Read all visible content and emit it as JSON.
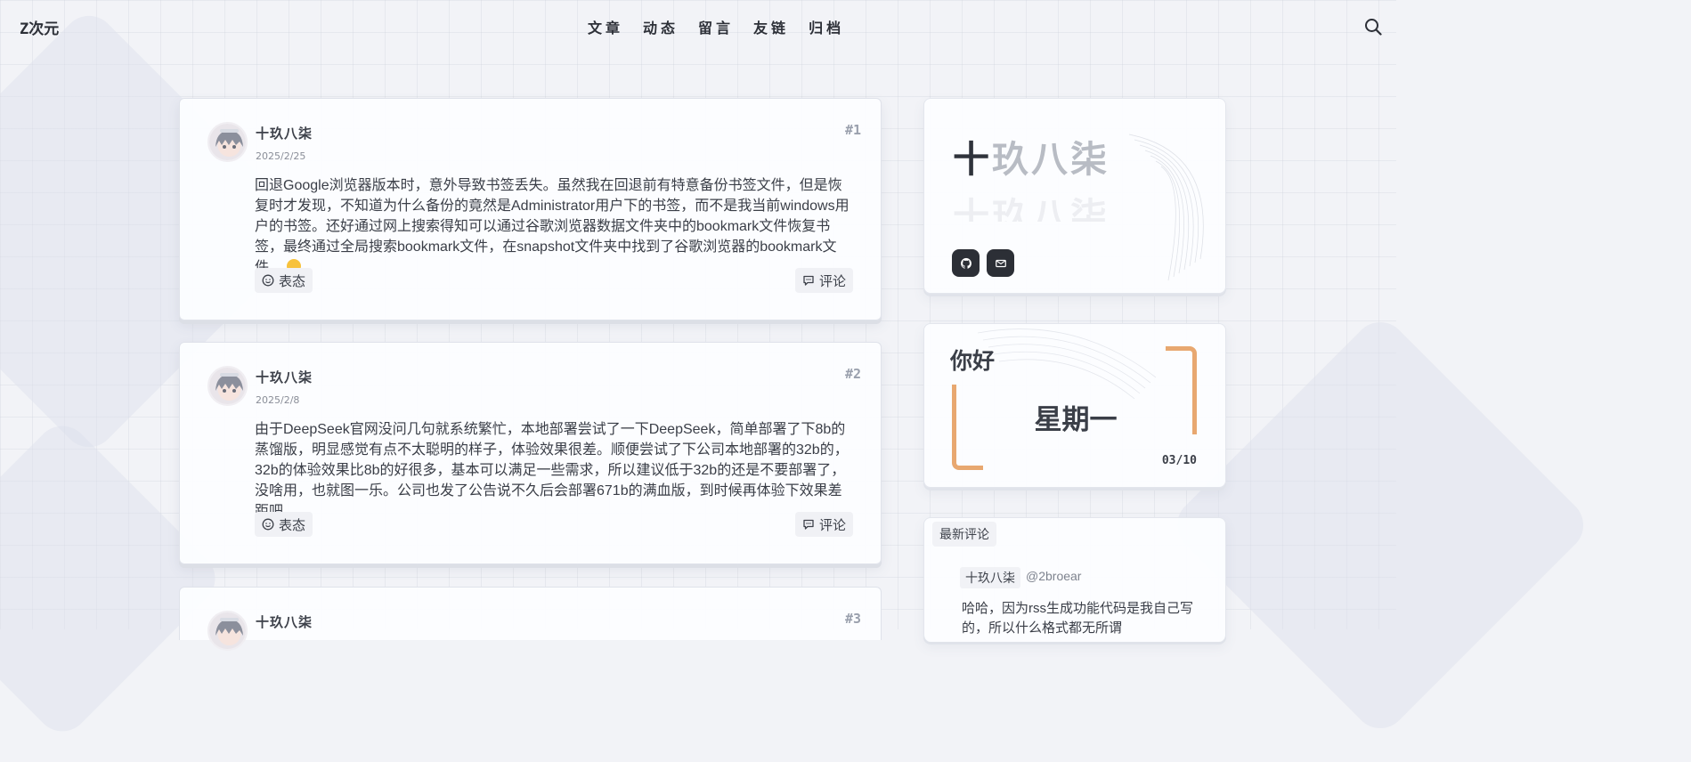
{
  "site": {
    "logo": "Z次元"
  },
  "nav": [
    {
      "label": "文章"
    },
    {
      "label": "动态"
    },
    {
      "label": "留言"
    },
    {
      "label": "友链"
    },
    {
      "label": "归档"
    }
  ],
  "posts": [
    {
      "number": "#1",
      "author": "十玖八柒",
      "date": "2025/2/25",
      "content": "回退Google浏览器版本时，意外导致书签丢失。虽然我在回退前有特意备份书签文件，但是恢复时才发现，不知道为什么备份的竟然是Administrator用户下的书签，而不是我当前windows用户的书签。还好通过网上搜索得知可以通过谷歌浏览器数据文件夹中的bookmark文件恢复书签，最终通过全局搜索bookmark文件，在snapshot文件夹中找到了谷歌浏览器的bookmark文件。",
      "react_label": "表态",
      "comment_label": "评论"
    },
    {
      "number": "#2",
      "author": "十玖八柒",
      "date": "2025/2/8",
      "content": "由于DeepSeek官网没问几句就系统繁忙，本地部署尝试了一下DeepSeek，简单部署了下8b的蒸馏版，明显感觉有点不太聪明的样子，体验效果很差。顺便尝试了下公司本地部署的32b的，32b的体验效果比8b的好很多，基本可以满足一些需求，所以建议低于32b的还是不要部署了，没啥用，也就图一乐。公司也发了公告说不久后会部署671b的满血版，到时候再体验下效果差距吧。",
      "react_label": "表态",
      "comment_label": "评论"
    },
    {
      "number": "#3",
      "author": "十玖八柒"
    }
  ],
  "profile": {
    "name_first": "十",
    "name_rest": "玖八柒",
    "shadow": "十玖八柒"
  },
  "greeting": {
    "hello": "你好",
    "weekday": "星期一",
    "date": "03/10"
  },
  "comments": {
    "title": "最新评论",
    "items": [
      {
        "author": "十玖八柒",
        "handle": "@2broear",
        "text": "哈哈，因为rss生成功能代码是我自己写的，所以什么格式都无所谓"
      }
    ]
  },
  "colors": {
    "accent_bracket": "#e8a870",
    "social_bg": "#2c2f36"
  },
  "icons": [
    "search-icon",
    "github-icon",
    "mail-icon",
    "smile-icon",
    "comment-icon"
  ]
}
